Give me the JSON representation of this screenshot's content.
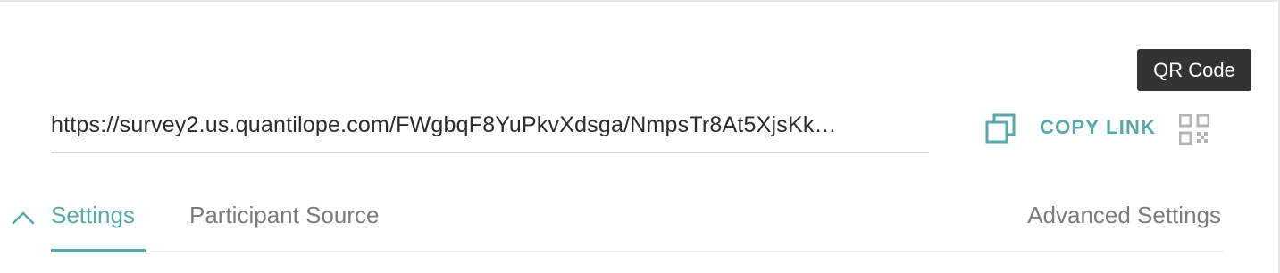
{
  "tooltip": {
    "text": "QR Code"
  },
  "link_row": {
    "url": "https://survey2.us.quantilope.com/FWgbqF8YuPkvXdsga/NmpsTr8At5XjsKk…",
    "copy_label": "COPY LINK"
  },
  "icons": {
    "copy": "copy-icon",
    "qr": "qr-code-icon",
    "collapse": "chevron-up-icon"
  },
  "tabs": [
    {
      "label": "Settings",
      "active": true
    },
    {
      "label": "Participant Source",
      "active": false
    }
  ],
  "advanced_tab": {
    "label": "Advanced Settings"
  },
  "colors": {
    "accent": "#57a8a6",
    "tooltip_bg": "#333333",
    "text_muted": "#7b7b7b"
  }
}
